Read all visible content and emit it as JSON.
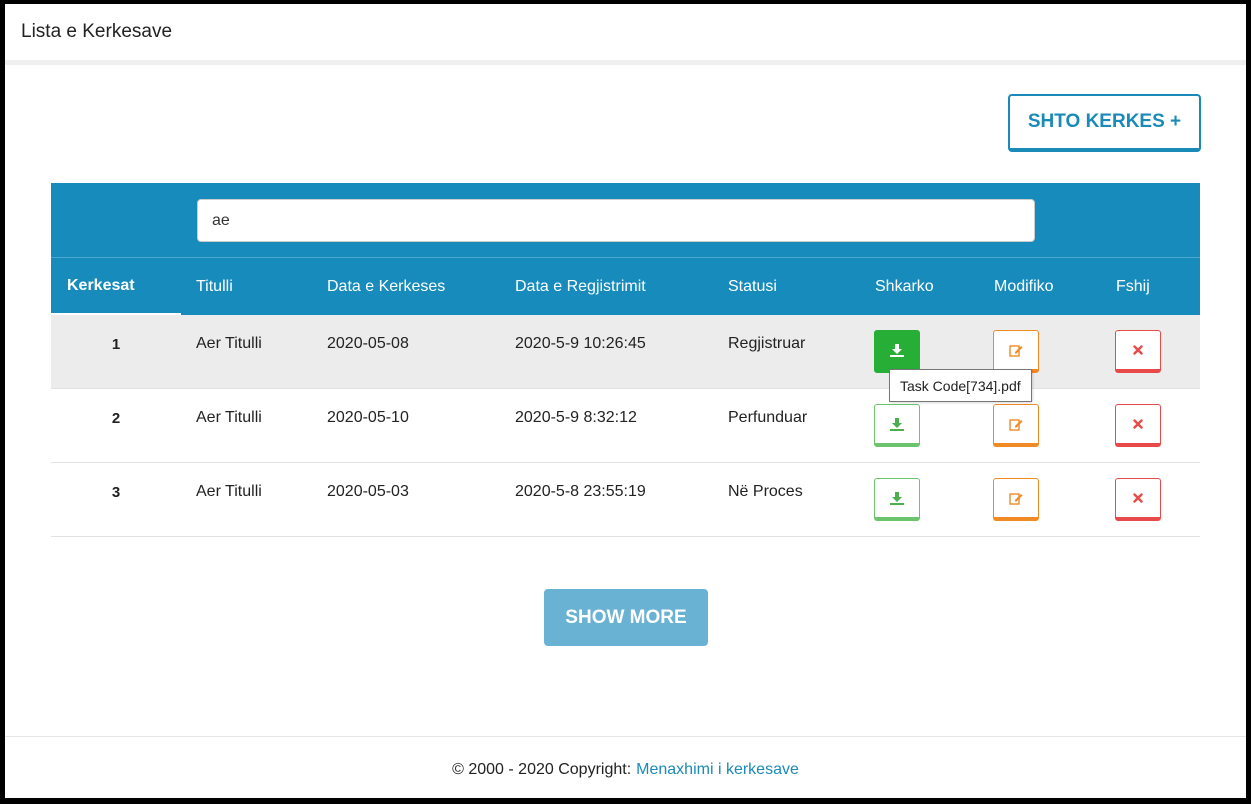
{
  "header": {
    "title": "Lista e Kerkesave"
  },
  "add_button": {
    "label": "SHTO KERKES +"
  },
  "search": {
    "value": "ae"
  },
  "table": {
    "columns": [
      "Kerkesat",
      "Titulli",
      "Data e Kerkeses",
      "Data e Regjistrimit",
      "Statusi",
      "Shkarko",
      "Modifiko",
      "Fshij"
    ],
    "rows": [
      {
        "num": "1",
        "title": "Aer Titulli",
        "request_date": "2020-05-08",
        "registration_date": "2020-5-9 10:26:45",
        "status": "Regjistruar"
      },
      {
        "num": "2",
        "title": "Aer Titulli",
        "request_date": "2020-05-10",
        "registration_date": "2020-5-9 8:32:12",
        "status": "Perfunduar"
      },
      {
        "num": "3",
        "title": "Aer Titulli",
        "request_date": "2020-05-03",
        "registration_date": "2020-5-8 23:55:19",
        "status": "Në Proces"
      }
    ]
  },
  "tooltip": {
    "text": "Task Code[734].pdf"
  },
  "show_more": {
    "label": "SHOW MORE"
  },
  "footer": {
    "copyright": "© 2000 - 2020 Copyright:",
    "link": "Menaxhimi i kerkesave"
  },
  "colors": {
    "primary": "#178bbb",
    "download": "#27ae37",
    "edit": "#f08a24",
    "delete": "#e84a4a",
    "show_more": "#6ab2d4"
  },
  "icons": {
    "download": "download-icon",
    "edit": "edit-icon",
    "delete": "close-icon"
  }
}
